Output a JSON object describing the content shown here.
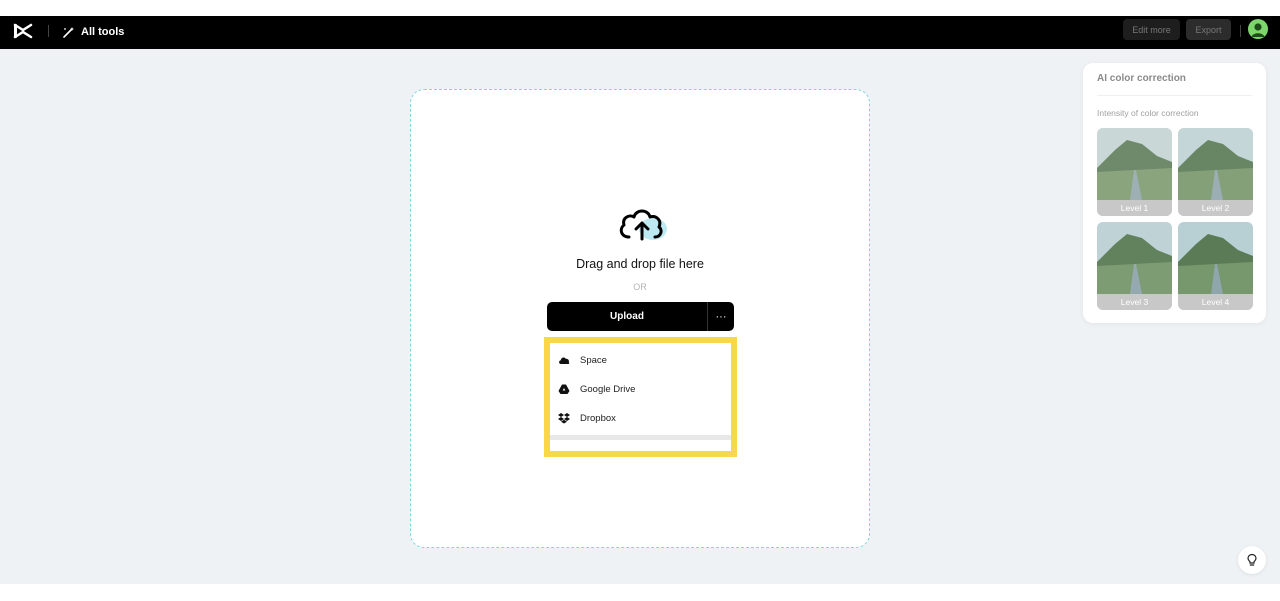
{
  "header": {
    "all_tools_label": "All tools",
    "edit_more_label": "Edit more",
    "export_label": "Export"
  },
  "upload": {
    "drag_text": "Drag and drop file here",
    "or_text": "OR",
    "upload_label": "Upload",
    "more_label": "···",
    "menu": [
      {
        "label": "Space",
        "icon": "cloud-icon"
      },
      {
        "label": "Google Drive",
        "icon": "google-drive-icon"
      },
      {
        "label": "Dropbox",
        "icon": "dropbox-icon"
      }
    ]
  },
  "panel": {
    "title": "AI color correction",
    "subtitle": "Intensity of color correction",
    "levels": [
      "Level 1",
      "Level 2",
      "Level 3",
      "Level 4"
    ]
  },
  "colors": {
    "header_bg": "#000000",
    "dropzone_border": "#7fd6e0",
    "highlight": "#f8d84b",
    "main_bg": "#eff2f5"
  }
}
